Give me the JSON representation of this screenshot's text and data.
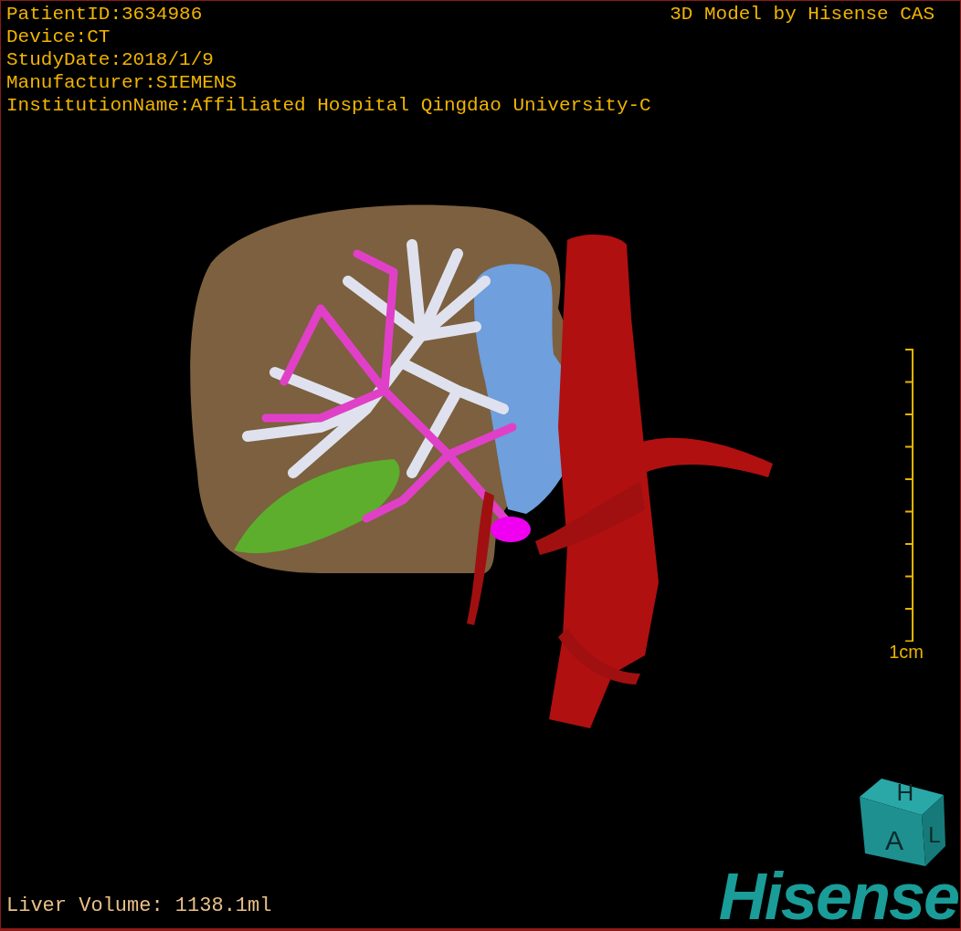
{
  "header": {
    "info_lines": [
      "PatientID:3634986",
      "Device:CT",
      "StudyDate:2018/1/9",
      "Manufacturer:SIEMENS",
      "InstitutionName:Affiliated Hospital Qingdao University-C"
    ],
    "title": "3D Model by Hisense CAS"
  },
  "viewport": {
    "scale_label": "1cm"
  },
  "orientation_cube": {
    "labels": [
      "H",
      "A",
      "L"
    ]
  },
  "footer": {
    "volume": "Liver Volume: 1138.1ml",
    "logo": "Hisense"
  }
}
